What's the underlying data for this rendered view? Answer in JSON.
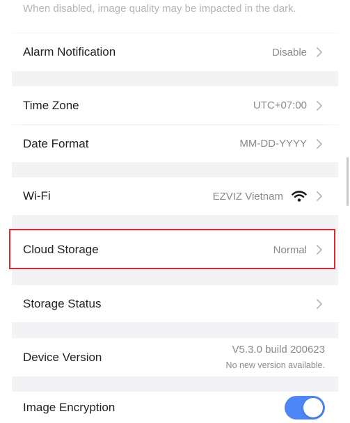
{
  "top_note": "When disabled, image quality may be impacted in the dark.",
  "settings": {
    "alarm_notification": {
      "label": "Alarm Notification",
      "value": "Disable"
    },
    "time_zone": {
      "label": "Time Zone",
      "value": "UTC+07:00"
    },
    "date_format": {
      "label": "Date Format",
      "value": "MM-DD-YYYY"
    },
    "wifi": {
      "label": "Wi-Fi",
      "value": "EZVIZ Vietnam",
      "icon": "wifi-icon"
    },
    "cloud_storage": {
      "label": "Cloud Storage",
      "value": "Normal"
    },
    "storage_status": {
      "label": "Storage Status"
    },
    "device_version": {
      "label": "Device Version",
      "value": "V5.3.0 build 200623",
      "note": "No new version available."
    },
    "image_encryption": {
      "label": "Image Encryption",
      "enabled": true
    }
  },
  "colors": {
    "highlight": "#e0262e",
    "toggle_on": "#4f86f7",
    "section_gap": "#f3f3f6"
  }
}
